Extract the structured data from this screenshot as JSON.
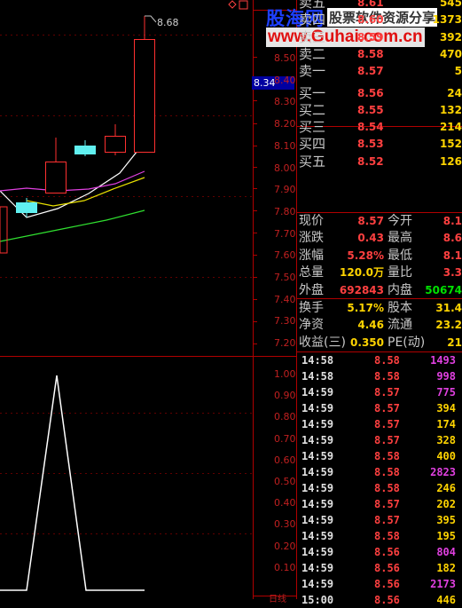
{
  "watermark": {
    "brand": "股海网",
    "tagline": "股票软件资源分享",
    "url": "www.Guhai.com.cn"
  },
  "chart": {
    "high_label": "8.68",
    "current_price": "8.34",
    "price_axis": [
      "8.50",
      "8.40",
      "8.30",
      "8.20",
      "8.10",
      "8.00",
      "7.90",
      "7.80",
      "7.70",
      "7.60",
      "7.50",
      "7.40",
      "7.30",
      "7.20"
    ],
    "indicator_axis": [
      "1.00",
      "0.90",
      "0.80",
      "0.70",
      "0.60",
      "0.50",
      "0.40",
      "0.30",
      "0.20",
      "0.10"
    ],
    "indicator_bottom_label": "日线"
  },
  "order_book": {
    "sell": [
      {
        "label": "卖五",
        "price": "8.61",
        "vol": "545"
      },
      {
        "label": "卖四",
        "price": "8.60",
        "vol": "1373"
      },
      {
        "label": "卖三",
        "price": "8.59",
        "vol": "392"
      },
      {
        "label": "卖二",
        "price": "8.58",
        "vol": "470"
      },
      {
        "label": "卖一",
        "price": "8.57",
        "vol": "5"
      }
    ],
    "buy": [
      {
        "label": "买一",
        "price": "8.56",
        "vol": "24"
      },
      {
        "label": "买二",
        "price": "8.55",
        "vol": "132"
      },
      {
        "label": "买三",
        "price": "8.54",
        "vol": "214"
      },
      {
        "label": "买四",
        "price": "8.53",
        "vol": "152"
      },
      {
        "label": "买五",
        "price": "8.52",
        "vol": "126"
      }
    ]
  },
  "stock_info": [
    {
      "l1": "现价",
      "v1": "8.57",
      "c1": "#ff4040",
      "l2": "今开",
      "v2": "8.1",
      "c2": "#ff4040"
    },
    {
      "l1": "涨跌",
      "v1": "0.43",
      "c1": "#ff4040",
      "l2": "最高",
      "v2": "8.6",
      "c2": "#ff4040"
    },
    {
      "l1": "涨幅",
      "v1": "5.28%",
      "c1": "#ff4040",
      "l2": "最低",
      "v2": "8.1",
      "c2": "#ff4040"
    },
    {
      "l1": "总量",
      "v1": "120.0万",
      "c1": "#ffd400",
      "l2": "量比",
      "v2": "3.3",
      "c2": "#ff4040"
    },
    {
      "l1": "外盘",
      "v1": "692843",
      "c1": "#ff4040",
      "l2": "内盘",
      "v2": "50674",
      "c2": "#00e000"
    },
    {
      "l1": "换手",
      "v1": "5.17%",
      "c1": "#ffd400",
      "l2": "股本",
      "v2": "31.4",
      "c2": "#ffd400"
    },
    {
      "l1": "净资",
      "v1": "4.46",
      "c1": "#ffd400",
      "l2": "流通",
      "v2": "23.2",
      "c2": "#ffd400"
    },
    {
      "l1": "收益(三)",
      "v1": "0.350",
      "c1": "#ffd400",
      "l2": "PE(动)",
      "v2": "21",
      "c2": "#ffd400"
    }
  ],
  "ticks": [
    {
      "time": "14:58",
      "price": "8.58",
      "vol": "1493",
      "vc": "#e040e0"
    },
    {
      "time": "14:58",
      "price": "8.58",
      "vol": "998",
      "vc": "#e040e0"
    },
    {
      "time": "14:59",
      "price": "8.57",
      "vol": "775",
      "vc": "#e040e0"
    },
    {
      "time": "14:59",
      "price": "8.57",
      "vol": "394",
      "vc": "#ffd400"
    },
    {
      "time": "14:59",
      "price": "8.57",
      "vol": "174",
      "vc": "#ffd400"
    },
    {
      "time": "14:59",
      "price": "8.57",
      "vol": "328",
      "vc": "#ffd400"
    },
    {
      "time": "14:59",
      "price": "8.58",
      "vol": "400",
      "vc": "#ffd400"
    },
    {
      "time": "14:59",
      "price": "8.58",
      "vol": "2823",
      "vc": "#e040e0"
    },
    {
      "time": "14:59",
      "price": "8.58",
      "vol": "246",
      "vc": "#ffd400"
    },
    {
      "time": "14:59",
      "price": "8.57",
      "vol": "202",
      "vc": "#ffd400"
    },
    {
      "time": "14:59",
      "price": "8.57",
      "vol": "395",
      "vc": "#ffd400"
    },
    {
      "time": "14:59",
      "price": "8.58",
      "vol": "195",
      "vc": "#ffd400"
    },
    {
      "time": "14:59",
      "price": "8.56",
      "vol": "804",
      "vc": "#e040e0"
    },
    {
      "time": "14:59",
      "price": "8.56",
      "vol": "182",
      "vc": "#ffd400"
    },
    {
      "time": "14:59",
      "price": "8.56",
      "vol": "2173",
      "vc": "#e040e0"
    },
    {
      "time": "15:00",
      "price": "8.56",
      "vol": "446",
      "vc": "#ffd400"
    }
  ]
}
